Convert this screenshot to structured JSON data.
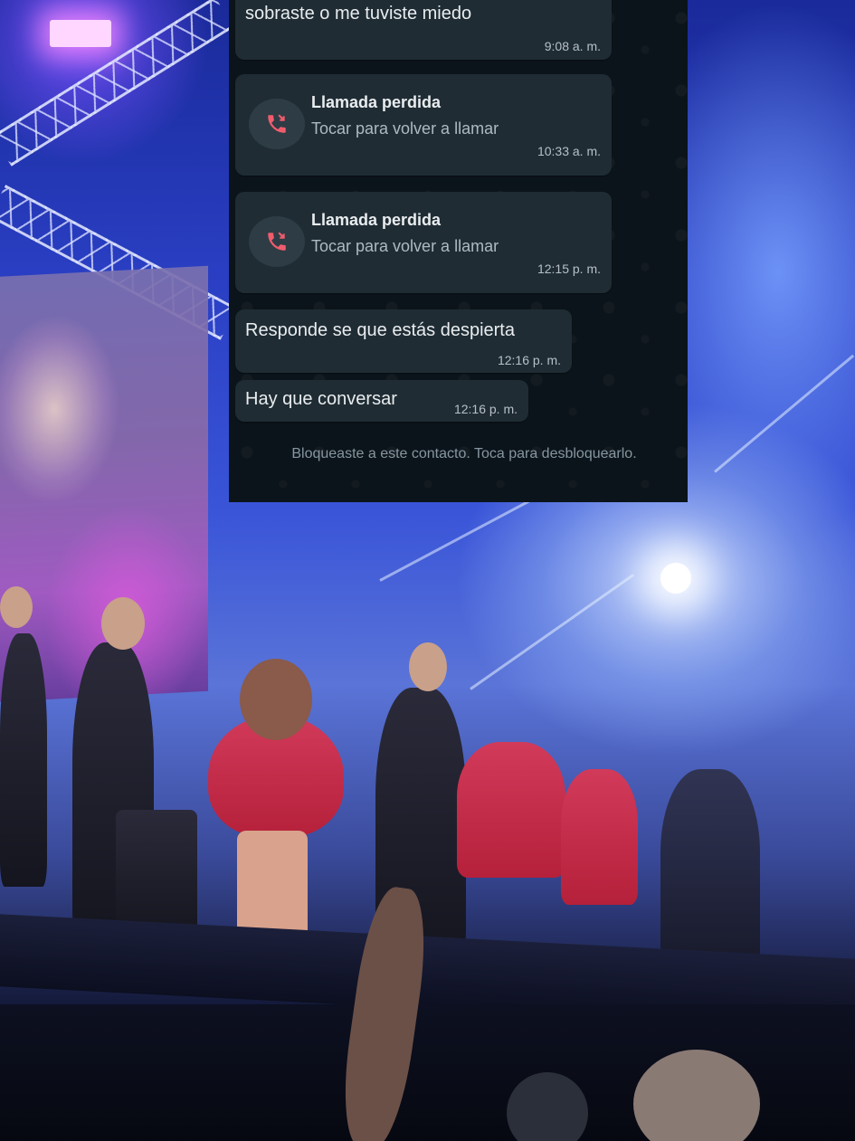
{
  "chat": {
    "messages": [
      {
        "type": "text",
        "text": "sobraste o me tuviste miedo",
        "time": "9:08 a. m."
      },
      {
        "type": "missed_call",
        "title": "Llamada perdida",
        "subtitle": "Tocar para volver a llamar",
        "time": "10:33 a. m.",
        "icon": "missed-call-icon"
      },
      {
        "type": "missed_call",
        "title": "Llamada perdida",
        "subtitle": "Tocar para volver a llamar",
        "time": "12:15 p. m.",
        "icon": "missed-call-icon"
      },
      {
        "type": "text",
        "text": "Responde se que estás despierta",
        "time": "12:16 p. m."
      },
      {
        "type": "text",
        "text": "Hay que conversar",
        "time": "12:16 p. m."
      }
    ],
    "blocked_notice": "Bloqueaste a este contacto. Toca para desbloquearlo.",
    "colors": {
      "background": "#0b141a",
      "bubble": "#1f2c34",
      "missed_call_icon": "#f15c6d",
      "text": "#e9edef",
      "meta": "#8696a0"
    }
  }
}
